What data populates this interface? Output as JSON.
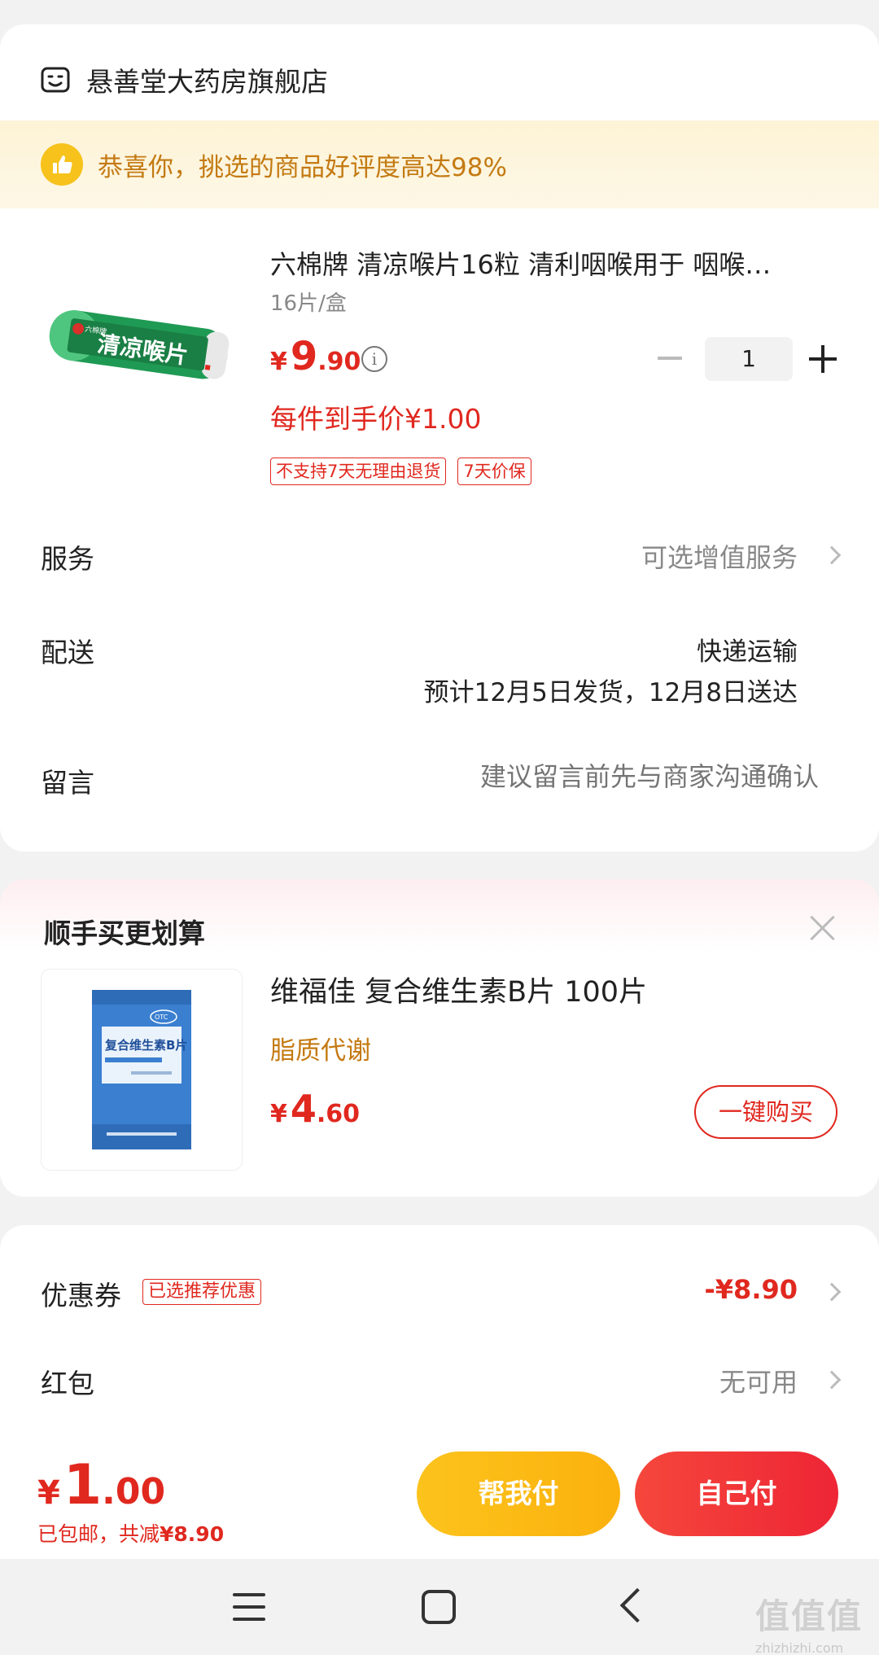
{
  "shop": {
    "name": "悬善堂大药房旗舰店"
  },
  "banner": {
    "text": "恭喜你，挑选的商品好评度高达98%"
  },
  "product": {
    "title": "六棉牌 清凉喉片16粒 清利咽喉用于 咽喉…",
    "spec": "16片/盒",
    "price_currency": "¥",
    "price_int": "9",
    "price_dec": ".90",
    "quantity": "1",
    "final_price": "每件到手价¥1.00",
    "tags": [
      "不支持7天无理由退货",
      "7天价保"
    ],
    "image_label": "清凉喉片",
    "image_brand": "六棉牌"
  },
  "service": {
    "label": "服务",
    "value": "可选增值服务"
  },
  "delivery": {
    "label": "配送",
    "method": "快递运输",
    "time": "预计12月5日发货，12月8日送达"
  },
  "message": {
    "label": "留言",
    "placeholder": "建议留言前先与商家沟通确认"
  },
  "addon": {
    "title": "顺手买更划算",
    "name": "维福佳 复合维生素B片 100片",
    "desc": "脂质代谢",
    "price_currency": "¥",
    "price_int": "4",
    "price_dec": ".60",
    "buy_label": "一键购买",
    "image_label": "复合维生素B片",
    "image_otc": "OTC"
  },
  "coupon": {
    "label": "优惠券",
    "tag": "已选推荐优惠",
    "value": "-¥8.90"
  },
  "redpacket": {
    "label": "红包",
    "value": "无可用"
  },
  "total": {
    "currency": "¥",
    "int": "1",
    "dec": ".00",
    "note_prefix": "已包邮，共减",
    "saved": "¥8.90"
  },
  "buttons": {
    "help_pay": "帮我付",
    "self_pay": "自己付"
  },
  "watermark": {
    "glyphs": "值值值",
    "url": "zhizhizhi.com"
  },
  "colors": {
    "accent": "#e0281f",
    "gold": "#c47a12",
    "yellow_btn": "#fcc31c",
    "red_btn": "#ee2535"
  },
  "icons": {
    "shop": "store-icon",
    "banner": "thumbs-up-icon",
    "info": "info-icon"
  }
}
